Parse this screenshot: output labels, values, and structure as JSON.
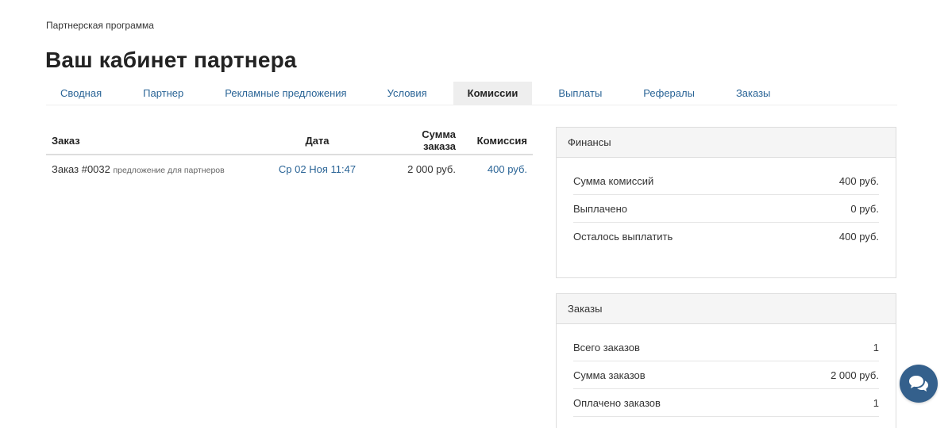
{
  "breadcrumb": "Партнерская программа",
  "title": "Ваш кабинет партнера",
  "tabs": [
    {
      "label": "Сводная",
      "active": false
    },
    {
      "label": "Партнер",
      "active": false
    },
    {
      "label": "Рекламные предложения",
      "active": false
    },
    {
      "label": "Условия",
      "active": false
    },
    {
      "label": "Комиссии",
      "active": true
    },
    {
      "label": "Выплаты",
      "active": false
    },
    {
      "label": "Рефералы",
      "active": false
    },
    {
      "label": "Заказы",
      "active": false
    }
  ],
  "commissions_table": {
    "headers": {
      "order": "Заказ",
      "date": "Дата",
      "order_sum": "Сумма заказа",
      "commission": "Комиссия"
    },
    "rows": [
      {
        "order": "Заказ #0032",
        "offer": "предложение для партнеров",
        "date": "Ср 02 Ноя 11:47",
        "order_sum": "2 000 руб.",
        "commission": "400 руб."
      }
    ]
  },
  "finances": {
    "heading": "Финансы",
    "rows": [
      {
        "label": "Сумма комиссий",
        "value": "400 руб."
      },
      {
        "label": "Выплачено",
        "value": "0 руб."
      },
      {
        "label": "Осталось выплатить",
        "value": "400 руб."
      }
    ]
  },
  "orders_summary": {
    "heading": "Заказы",
    "rows": [
      {
        "label": "Всего заказов",
        "value": "1"
      },
      {
        "label": "Сумма заказов",
        "value": "2 000 руб."
      },
      {
        "label": "Оплачено заказов",
        "value": "1"
      }
    ]
  },
  "colors": {
    "link": "#2a6496",
    "chat_button": "#34608c",
    "active_tab_bg": "#eeeeee"
  },
  "icons": {
    "chat": "chat-bubbles-icon"
  }
}
